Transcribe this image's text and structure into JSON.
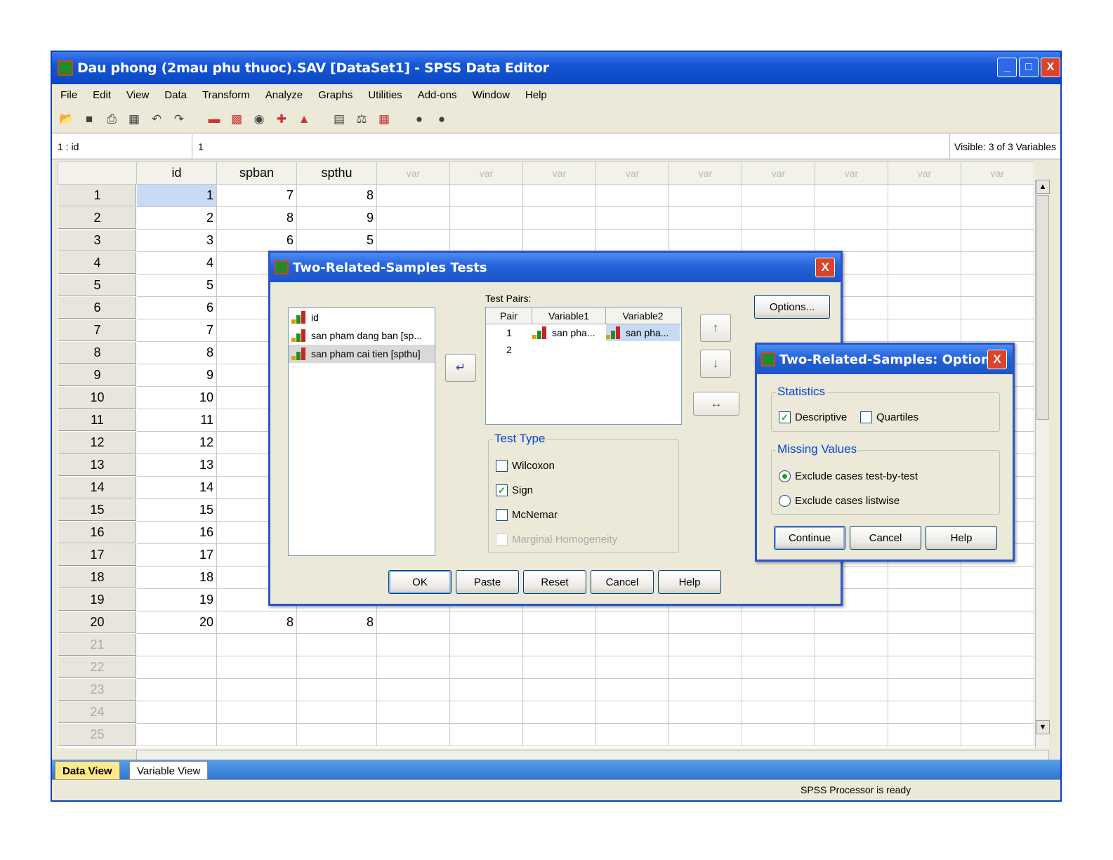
{
  "window": {
    "title": "Dau phong (2mau phu thuoc).SAV [DataSet1] - SPSS Data Editor",
    "min": "_",
    "max": "□",
    "close": "X"
  },
  "menu": [
    "File",
    "Edit",
    "View",
    "Data",
    "Transform",
    "Analyze",
    "Graphs",
    "Utilities",
    "Add-ons",
    "Window",
    "Help"
  ],
  "cellbar": {
    "ref": "1 : id",
    "value": "1",
    "visible": "Visible: 3 of 3 Variables"
  },
  "grid": {
    "columns": [
      "id",
      "spban",
      "spthu",
      "var",
      "var",
      "var",
      "var",
      "var",
      "var",
      "var",
      "var",
      "var"
    ],
    "rows": [
      {
        "n": "1",
        "id": "1",
        "spban": "7",
        "spthu": "8"
      },
      {
        "n": "2",
        "id": "2",
        "spban": "8",
        "spthu": "9"
      },
      {
        "n": "3",
        "id": "3",
        "spban": "6",
        "spthu": "5"
      },
      {
        "n": "4",
        "id": "4",
        "spban": "",
        "spthu": ""
      },
      {
        "n": "5",
        "id": "5",
        "spban": "",
        "spthu": ""
      },
      {
        "n": "6",
        "id": "6",
        "spban": "",
        "spthu": ""
      },
      {
        "n": "7",
        "id": "7",
        "spban": "",
        "spthu": ""
      },
      {
        "n": "8",
        "id": "8",
        "spban": "",
        "spthu": ""
      },
      {
        "n": "9",
        "id": "9",
        "spban": "",
        "spthu": ""
      },
      {
        "n": "10",
        "id": "10",
        "spban": "",
        "spthu": ""
      },
      {
        "n": "11",
        "id": "11",
        "spban": "",
        "spthu": ""
      },
      {
        "n": "12",
        "id": "12",
        "spban": "",
        "spthu": ""
      },
      {
        "n": "13",
        "id": "13",
        "spban": "",
        "spthu": ""
      },
      {
        "n": "14",
        "id": "14",
        "spban": "",
        "spthu": ""
      },
      {
        "n": "15",
        "id": "15",
        "spban": "",
        "spthu": ""
      },
      {
        "n": "16",
        "id": "16",
        "spban": "",
        "spthu": ""
      },
      {
        "n": "17",
        "id": "17",
        "spban": "",
        "spthu": ""
      },
      {
        "n": "18",
        "id": "18",
        "spban": "",
        "spthu": ""
      },
      {
        "n": "19",
        "id": "19",
        "spban": "",
        "spthu": ""
      },
      {
        "n": "20",
        "id": "20",
        "spban": "8",
        "spthu": "8"
      },
      {
        "n": "21",
        "id": "",
        "spban": "",
        "spthu": ""
      },
      {
        "n": "22",
        "id": "",
        "spban": "",
        "spthu": ""
      },
      {
        "n": "23",
        "id": "",
        "spban": "",
        "spthu": ""
      },
      {
        "n": "24",
        "id": "",
        "spban": "",
        "spthu": ""
      },
      {
        "n": "25",
        "id": "",
        "spban": "",
        "spthu": ""
      }
    ]
  },
  "tabs": {
    "data_view": "Data View",
    "variable_view": "Variable View"
  },
  "status": "SPSS  Processor is ready",
  "dialog_main": {
    "title": "Two-Related-Samples Tests",
    "close": "X",
    "variables": [
      "id",
      "san pham dang ban [sp...",
      "san pham cai tien [spthu]"
    ],
    "test_pairs_label": "Test Pairs:",
    "pairs_headers": [
      "Pair",
      "Variable1",
      "Variable2"
    ],
    "pairs": [
      {
        "pair": "1",
        "v1": "san pha...",
        "v2": "san pha..."
      },
      {
        "pair": "2",
        "v1": "",
        "v2": ""
      }
    ],
    "options_btn": "Options...",
    "test_type_title": "Test Type",
    "wilcoxon": "Wilcoxon",
    "sign": "Sign",
    "mcnemar": "McNemar",
    "marginal": "Marginal Homogeneity",
    "ok": "OK",
    "paste": "Paste",
    "reset": "Reset",
    "cancel": "Cancel",
    "help": "Help"
  },
  "dialog_options": {
    "title": "Two-Related-Samples: Options",
    "close": "X",
    "statistics_title": "Statistics",
    "descriptive": "Descriptive",
    "quartiles": "Quartiles",
    "missing_title": "Missing Values",
    "exclude_test": "Exclude cases test-by-test",
    "exclude_list": "Exclude cases listwise",
    "continue": "Continue",
    "cancel": "Cancel",
    "help": "Help"
  },
  "icons": [
    "open-icon",
    "save-icon",
    "print-icon",
    "dialog-recall-icon",
    "undo-icon",
    "redo-icon",
    "goto-case-icon",
    "variables-icon",
    "find-icon",
    "insert-cases-icon",
    "insert-variable-icon",
    "split-file-icon",
    "weight-cases-icon",
    "select-cases-icon",
    "value-labels-icon",
    "use-sets-icon"
  ]
}
